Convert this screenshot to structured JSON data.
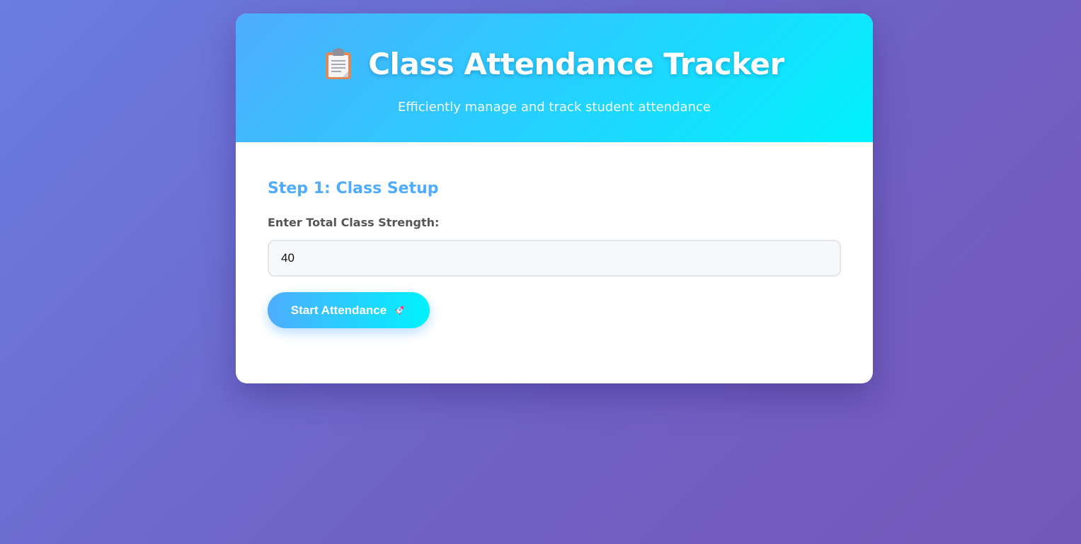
{
  "header": {
    "icon": "clipboard-icon",
    "title": "Class Attendance Tracker",
    "subtitle": "Efficiently manage and track student attendance"
  },
  "setup": {
    "step_title": "Step 1: Class Setup",
    "strength_label": "Enter Total Class Strength:",
    "strength_value": "40",
    "start_button_label": "Start Attendance",
    "start_button_icon": "rocket-icon"
  },
  "colors": {
    "accent": "#4facfe",
    "accent_end": "#00f2fe",
    "background_start": "#6a7de0",
    "background_end": "#7458b8"
  }
}
